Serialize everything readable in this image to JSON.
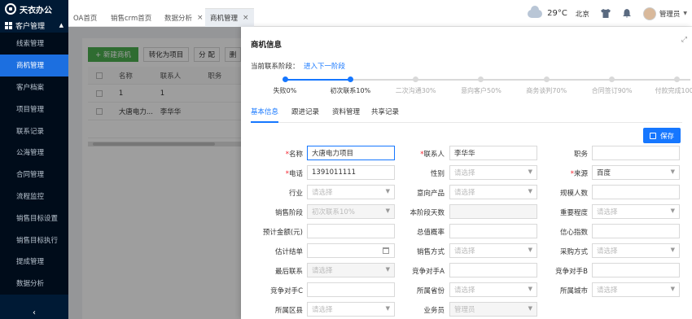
{
  "app": {
    "name": "天衣办公"
  },
  "sidebar": {
    "group": "客户管理",
    "items": [
      {
        "label": "线索管理",
        "active": false
      },
      {
        "label": "商机管理",
        "active": true
      },
      {
        "label": "客户档案",
        "active": false
      },
      {
        "label": "项目管理",
        "active": false
      },
      {
        "label": "联系记录",
        "active": false
      },
      {
        "label": "公海管理",
        "active": false
      },
      {
        "label": "合同管理",
        "active": false
      },
      {
        "label": "流程监控",
        "active": false
      },
      {
        "label": "销售目标设置",
        "active": false
      },
      {
        "label": "销售目标执行",
        "active": false
      },
      {
        "label": "提成管理",
        "active": false
      },
      {
        "label": "数据分析",
        "active": false
      }
    ],
    "collapse": "‹"
  },
  "tabs": [
    {
      "label": "OA首页",
      "closable": false,
      "active": false
    },
    {
      "label": "销售crm首页",
      "closable": false,
      "active": false
    },
    {
      "label": "数据分析",
      "closable": true,
      "active": false
    },
    {
      "label": "商机管理",
      "closable": true,
      "active": true
    }
  ],
  "header": {
    "temperature": "29°C",
    "city": "北京",
    "user": "管理员",
    "icons": [
      "cloud-icon",
      "shirt-icon",
      "bell-icon",
      "avatar"
    ]
  },
  "background": {
    "buttons": [
      "+ 新建商机",
      "转化为项目",
      "分 配",
      "删"
    ],
    "table": {
      "headers": [
        "名称",
        "联系人",
        "职务"
      ],
      "rows": [
        [
          "1",
          "1",
          ""
        ],
        [
          "大唐电力...",
          "李华华",
          ""
        ]
      ]
    }
  },
  "drawer": {
    "title": "商机信息",
    "stage_label": "当前联系阶段：",
    "stage_action": "进入下一阶段",
    "steps": [
      {
        "label": "失败0%",
        "done": true
      },
      {
        "label": "初次联系10%",
        "done": true
      },
      {
        "label": "二次沟通30%",
        "done": false
      },
      {
        "label": "意向客户50%",
        "done": false
      },
      {
        "label": "商务谈判70%",
        "done": false
      },
      {
        "label": "合同签订90%",
        "done": false
      },
      {
        "label": "付款完成100%",
        "done": false
      }
    ],
    "tabs": [
      {
        "label": "基本信息",
        "active": true
      },
      {
        "label": "跟进记录",
        "active": false
      },
      {
        "label": "资料管理",
        "active": false
      },
      {
        "label": "共享记录",
        "active": false
      }
    ],
    "save_label": "保存",
    "fields": [
      {
        "label": "名称",
        "required": true,
        "value": "大唐电力项目",
        "kind": "text",
        "state": "focus"
      },
      {
        "label": "联系人",
        "required": true,
        "value": "李华华",
        "kind": "text",
        "state": ""
      },
      {
        "label": "职务",
        "required": false,
        "value": "",
        "kind": "text",
        "state": ""
      },
      {
        "label": "电话",
        "required": true,
        "value": "1391011111",
        "kind": "text",
        "state": ""
      },
      {
        "label": "性别",
        "required": false,
        "value": "请选择",
        "kind": "select",
        "state": "ph"
      },
      {
        "label": "来源",
        "required": true,
        "value": "百度",
        "kind": "select",
        "state": ""
      },
      {
        "label": "行业",
        "required": false,
        "value": "请选择",
        "kind": "select",
        "state": "ph"
      },
      {
        "label": "意向产品",
        "required": false,
        "value": "请选择",
        "kind": "select",
        "state": "ph"
      },
      {
        "label": "规模人数",
        "required": false,
        "value": "",
        "kind": "text",
        "state": ""
      },
      {
        "label": "销售阶段",
        "required": false,
        "value": "初次联系10%",
        "kind": "select",
        "state": "dis ph"
      },
      {
        "label": "本阶段天数",
        "required": false,
        "value": "",
        "kind": "text",
        "state": "dis"
      },
      {
        "label": "重要程度",
        "required": false,
        "value": "请选择",
        "kind": "select",
        "state": "ph"
      },
      {
        "label": "预计金额(元)",
        "required": false,
        "value": "",
        "kind": "text",
        "state": ""
      },
      {
        "label": "总值概率",
        "required": false,
        "value": "",
        "kind": "text",
        "state": ""
      },
      {
        "label": "信心指数",
        "required": false,
        "value": "",
        "kind": "text",
        "state": ""
      },
      {
        "label": "估计结单",
        "required": false,
        "value": "",
        "kind": "date",
        "state": ""
      },
      {
        "label": "销售方式",
        "required": false,
        "value": "请选择",
        "kind": "select",
        "state": "ph"
      },
      {
        "label": "采购方式",
        "required": false,
        "value": "请选择",
        "kind": "select",
        "state": "ph"
      },
      {
        "label": "最后联系",
        "required": false,
        "value": "请选择",
        "kind": "select",
        "state": "dis ph"
      },
      {
        "label": "竞争对手A",
        "required": false,
        "value": "",
        "kind": "text",
        "state": ""
      },
      {
        "label": "竞争对手B",
        "required": false,
        "value": "",
        "kind": "text",
        "state": ""
      },
      {
        "label": "竞争对手C",
        "required": false,
        "value": "",
        "kind": "text",
        "state": ""
      },
      {
        "label": "所属省份",
        "required": false,
        "value": "请选择",
        "kind": "select",
        "state": "ph"
      },
      {
        "label": "所属城市",
        "required": false,
        "value": "请选择",
        "kind": "select",
        "state": "ph"
      },
      {
        "label": "所属区县",
        "required": false,
        "value": "请选择",
        "kind": "select",
        "state": "ph"
      },
      {
        "label": "业务员",
        "required": false,
        "value": "管理员",
        "kind": "select",
        "state": "dis ph"
      }
    ]
  }
}
